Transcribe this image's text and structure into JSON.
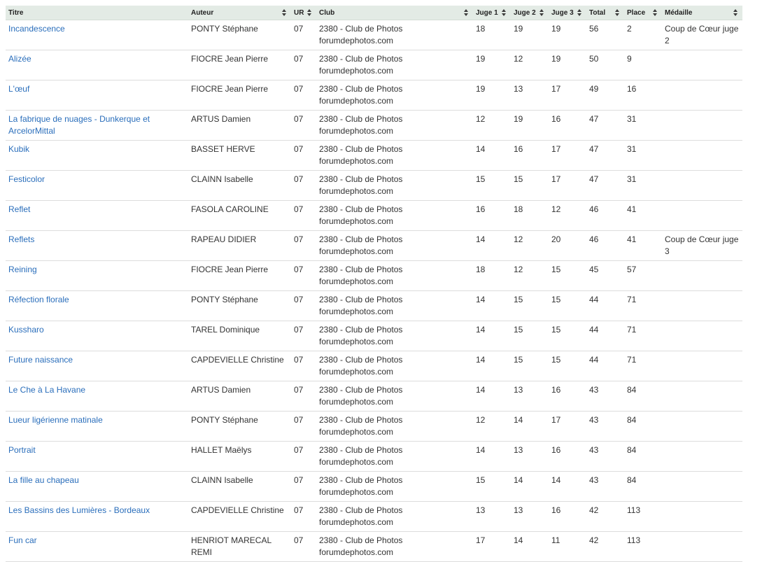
{
  "columns": [
    {
      "key": "titre",
      "label": "Titre",
      "sortable": false
    },
    {
      "key": "auteur",
      "label": "Auteur",
      "sortable": true
    },
    {
      "key": "ur",
      "label": "UR",
      "sortable": true
    },
    {
      "key": "club",
      "label": "Club",
      "sortable": true
    },
    {
      "key": "juge1",
      "label": "Juge 1",
      "sortable": true
    },
    {
      "key": "juge2",
      "label": "Juge 2",
      "sortable": true
    },
    {
      "key": "juge3",
      "label": "Juge 3",
      "sortable": true
    },
    {
      "key": "total",
      "label": "Total",
      "sortable": true
    },
    {
      "key": "place",
      "label": "Place",
      "sortable": true
    },
    {
      "key": "medaille",
      "label": "Médaille",
      "sortable": true
    }
  ],
  "rows": [
    {
      "titre": "Incandescence",
      "auteur": "PONTY Stéphane",
      "ur": "07",
      "club": "2380 - Club de Photos forumdephotos.com",
      "juge1": "18",
      "juge2": "19",
      "juge3": "19",
      "total": "56",
      "place": "2",
      "medaille": "Coup de Cœur juge 2"
    },
    {
      "titre": "Alizée",
      "auteur": "FIOCRE Jean Pierre",
      "ur": "07",
      "club": "2380 - Club de Photos forumdephotos.com",
      "juge1": "19",
      "juge2": "12",
      "juge3": "19",
      "total": "50",
      "place": "9",
      "medaille": ""
    },
    {
      "titre": "L'œuf",
      "auteur": "FIOCRE Jean Pierre",
      "ur": "07",
      "club": "2380 - Club de Photos forumdephotos.com",
      "juge1": "19",
      "juge2": "13",
      "juge3": "17",
      "total": "49",
      "place": "16",
      "medaille": ""
    },
    {
      "titre": "La fabrique de nuages - Dunkerque et ArcelorMittal",
      "auteur": "ARTUS Damien",
      "ur": "07",
      "club": "2380 - Club de Photos forumdephotos.com",
      "juge1": "12",
      "juge2": "19",
      "juge3": "16",
      "total": "47",
      "place": "31",
      "medaille": ""
    },
    {
      "titre": "Kubik",
      "auteur": "BASSET HERVE",
      "ur": "07",
      "club": "2380 - Club de Photos forumdephotos.com",
      "juge1": "14",
      "juge2": "16",
      "juge3": "17",
      "total": "47",
      "place": "31",
      "medaille": ""
    },
    {
      "titre": "Festicolor",
      "auteur": "CLAINN Isabelle",
      "ur": "07",
      "club": "2380 - Club de Photos forumdephotos.com",
      "juge1": "15",
      "juge2": "15",
      "juge3": "17",
      "total": "47",
      "place": "31",
      "medaille": ""
    },
    {
      "titre": "Reflet",
      "auteur": "FASOLA CAROLINE",
      "ur": "07",
      "club": "2380 - Club de Photos forumdephotos.com",
      "juge1": "16",
      "juge2": "18",
      "juge3": "12",
      "total": "46",
      "place": "41",
      "medaille": ""
    },
    {
      "titre": "Reflets",
      "auteur": "RAPEAU DIDIER",
      "ur": "07",
      "club": "2380 - Club de Photos forumdephotos.com",
      "juge1": "14",
      "juge2": "12",
      "juge3": "20",
      "total": "46",
      "place": "41",
      "medaille": "Coup de Cœur juge 3"
    },
    {
      "titre": "Reining",
      "auteur": "FIOCRE Jean Pierre",
      "ur": "07",
      "club": "2380 - Club de Photos forumdephotos.com",
      "juge1": "18",
      "juge2": "12",
      "juge3": "15",
      "total": "45",
      "place": "57",
      "medaille": ""
    },
    {
      "titre": "Réfection florale",
      "auteur": "PONTY Stéphane",
      "ur": "07",
      "club": "2380 - Club de Photos forumdephotos.com",
      "juge1": "14",
      "juge2": "15",
      "juge3": "15",
      "total": "44",
      "place": "71",
      "medaille": ""
    },
    {
      "titre": "Kussharo",
      "auteur": "TAREL Dominique",
      "ur": "07",
      "club": "2380 - Club de Photos forumdephotos.com",
      "juge1": "14",
      "juge2": "15",
      "juge3": "15",
      "total": "44",
      "place": "71",
      "medaille": ""
    },
    {
      "titre": "Future naissance",
      "auteur": "CAPDEVIELLE Christine",
      "ur": "07",
      "club": "2380 - Club de Photos forumdephotos.com",
      "juge1": "14",
      "juge2": "15",
      "juge3": "15",
      "total": "44",
      "place": "71",
      "medaille": ""
    },
    {
      "titre": "Le Che à La Havane",
      "auteur": "ARTUS Damien",
      "ur": "07",
      "club": "2380 - Club de Photos forumdephotos.com",
      "juge1": "14",
      "juge2": "13",
      "juge3": "16",
      "total": "43",
      "place": "84",
      "medaille": ""
    },
    {
      "titre": "Lueur ligérienne matinale",
      "auteur": "PONTY Stéphane",
      "ur": "07",
      "club": "2380 - Club de Photos forumdephotos.com",
      "juge1": "12",
      "juge2": "14",
      "juge3": "17",
      "total": "43",
      "place": "84",
      "medaille": ""
    },
    {
      "titre": "Portrait",
      "auteur": "HALLET Maëlys",
      "ur": "07",
      "club": "2380 - Club de Photos forumdephotos.com",
      "juge1": "14",
      "juge2": "13",
      "juge3": "16",
      "total": "43",
      "place": "84",
      "medaille": ""
    },
    {
      "titre": "La fille au chapeau",
      "auteur": "CLAINN Isabelle",
      "ur": "07",
      "club": "2380 - Club de Photos forumdephotos.com",
      "juge1": "15",
      "juge2": "14",
      "juge3": "14",
      "total": "43",
      "place": "84",
      "medaille": ""
    },
    {
      "titre": "Les Bassins des Lumières - Bordeaux",
      "auteur": "CAPDEVIELLE Christine",
      "ur": "07",
      "club": "2380 - Club de Photos forumdephotos.com",
      "juge1": "13",
      "juge2": "13",
      "juge3": "16",
      "total": "42",
      "place": "113",
      "medaille": ""
    },
    {
      "titre": "Fun car",
      "auteur": "HENRIOT MARECAL REMI",
      "ur": "07",
      "club": "2380 - Club de Photos forumdephotos.com",
      "juge1": "17",
      "juge2": "14",
      "juge3": "11",
      "total": "42",
      "place": "113",
      "medaille": ""
    }
  ]
}
